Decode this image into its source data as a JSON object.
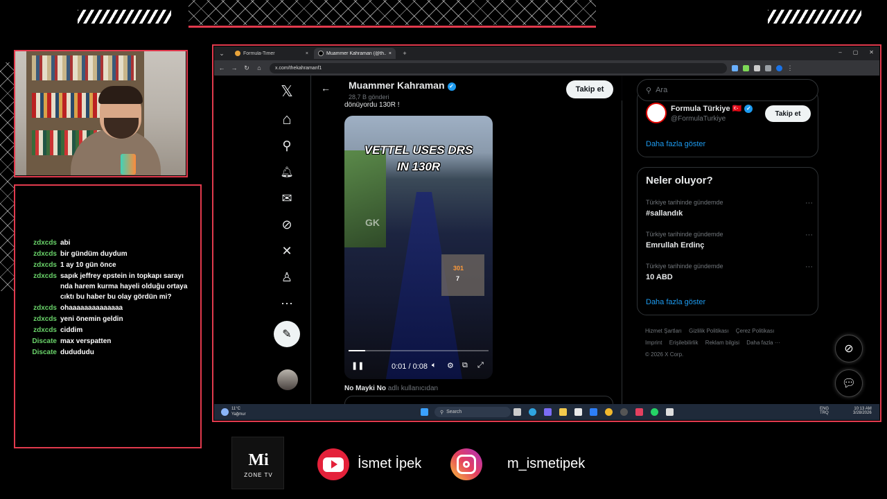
{
  "chat": {
    "messages": [
      {
        "user": "zdxcds",
        "text": "abi"
      },
      {
        "user": "zdxcds",
        "text": "bir gündüm duydum"
      },
      {
        "user": "zdxcds",
        "text": "1 ay 10 gün önce"
      },
      {
        "user": "zdxcds",
        "text": "sapık jeffrey epstein in topkapı sarayı nda harem kurma hayeli olduğu ortaya cıktı bu haber bu olay gördün mi?"
      },
      {
        "user": "zdxcds",
        "text": "ohaaaaaaaaaaaaaa"
      },
      {
        "user": "zdxcds",
        "text": "yeni önemin geldin"
      },
      {
        "user": "zdxcds",
        "text": "ciddim"
      },
      {
        "user": "Discate",
        "text": "max verspatten"
      },
      {
        "user": "Discate",
        "text": "dudududu"
      }
    ]
  },
  "browser": {
    "tabs": [
      {
        "title": "Formula-Timer",
        "active": false,
        "close": "×"
      },
      {
        "title": "Muammer Kahraman (@th...",
        "active": true,
        "close": "×"
      }
    ],
    "new_tab": "+",
    "url": "x.com/thekahramanf1",
    "window_controls": [
      "–",
      "▢",
      "✕"
    ]
  },
  "x_nav": [
    {
      "icon": "x-logo-icon",
      "glyph": "𝕏"
    },
    {
      "icon": "home-icon",
      "glyph": "⌂"
    },
    {
      "icon": "search-icon",
      "glyph": "⚲"
    },
    {
      "icon": "bell-icon",
      "glyph": "🔔︎"
    },
    {
      "icon": "mail-icon",
      "glyph": "✉"
    },
    {
      "icon": "grok-icon",
      "glyph": "⊘"
    },
    {
      "icon": "x-premium-icon",
      "glyph": "✕"
    },
    {
      "icon": "profile-icon",
      "glyph": "♙"
    },
    {
      "icon": "more-icon",
      "glyph": "⋯"
    }
  ],
  "profile": {
    "name": "Muammer Kahraman",
    "posts": "28,7 B gönderi",
    "follow_label": "Takip et",
    "cut_text": "dönüyordu 130R !"
  },
  "video": {
    "caption_line1": "VETTEL USES DRS",
    "caption_line2": "IN 130R",
    "watermark": "GK",
    "dash_speed": "301",
    "dash_gear": "7",
    "time": "0:01 / 0:08",
    "progress": 0.12
  },
  "reply": {
    "name": "No Mayki No",
    "suffix": "adlı kullanıcıdan"
  },
  "sidebar": {
    "search_placeholder": "Ara",
    "who_to_follow": {
      "name": "Formula Türkiye",
      "flag": "🇹🇷",
      "handle": "@FormulaTurkiye",
      "follow_label": "Takip et",
      "more": "Daha fazla göster"
    },
    "trends": {
      "title": "Neler oluyor?",
      "items": [
        {
          "context": "Türkiye tarihinde gündemde",
          "name": "#sallandık"
        },
        {
          "context": "Türkiye tarihinde gündemde",
          "name": "Emrullah Erdinç"
        },
        {
          "context": "Türkiye tarihinde gündemde",
          "name": "10 ABD"
        }
      ],
      "more": "Daha fazla göster"
    },
    "footer": [
      "Hizmet Şartları",
      "Gizlilik Politikası",
      "Çerez Politikası",
      "Imprint",
      "Erişilebilirlik",
      "Reklam bilgisi",
      "Daha fazla ···",
      "© 2026 X Corp."
    ]
  },
  "taskbar": {
    "weather_temp": "11°C",
    "weather_desc": "Yağmur",
    "search_label": "Search",
    "lang1": "ENG",
    "lang2": "TRQ",
    "time": "10:13 AM",
    "date": "3/28/2026"
  },
  "overlay": {
    "logo_main": "Mi",
    "logo_sub": "ZONE TV",
    "youtube_name": "İsmet İpek",
    "instagram_name": "m_ismetipek"
  },
  "colors": {
    "frame": "#e23a4d",
    "chat_user": "#6ad46a",
    "x_blue": "#1d9bf0"
  }
}
